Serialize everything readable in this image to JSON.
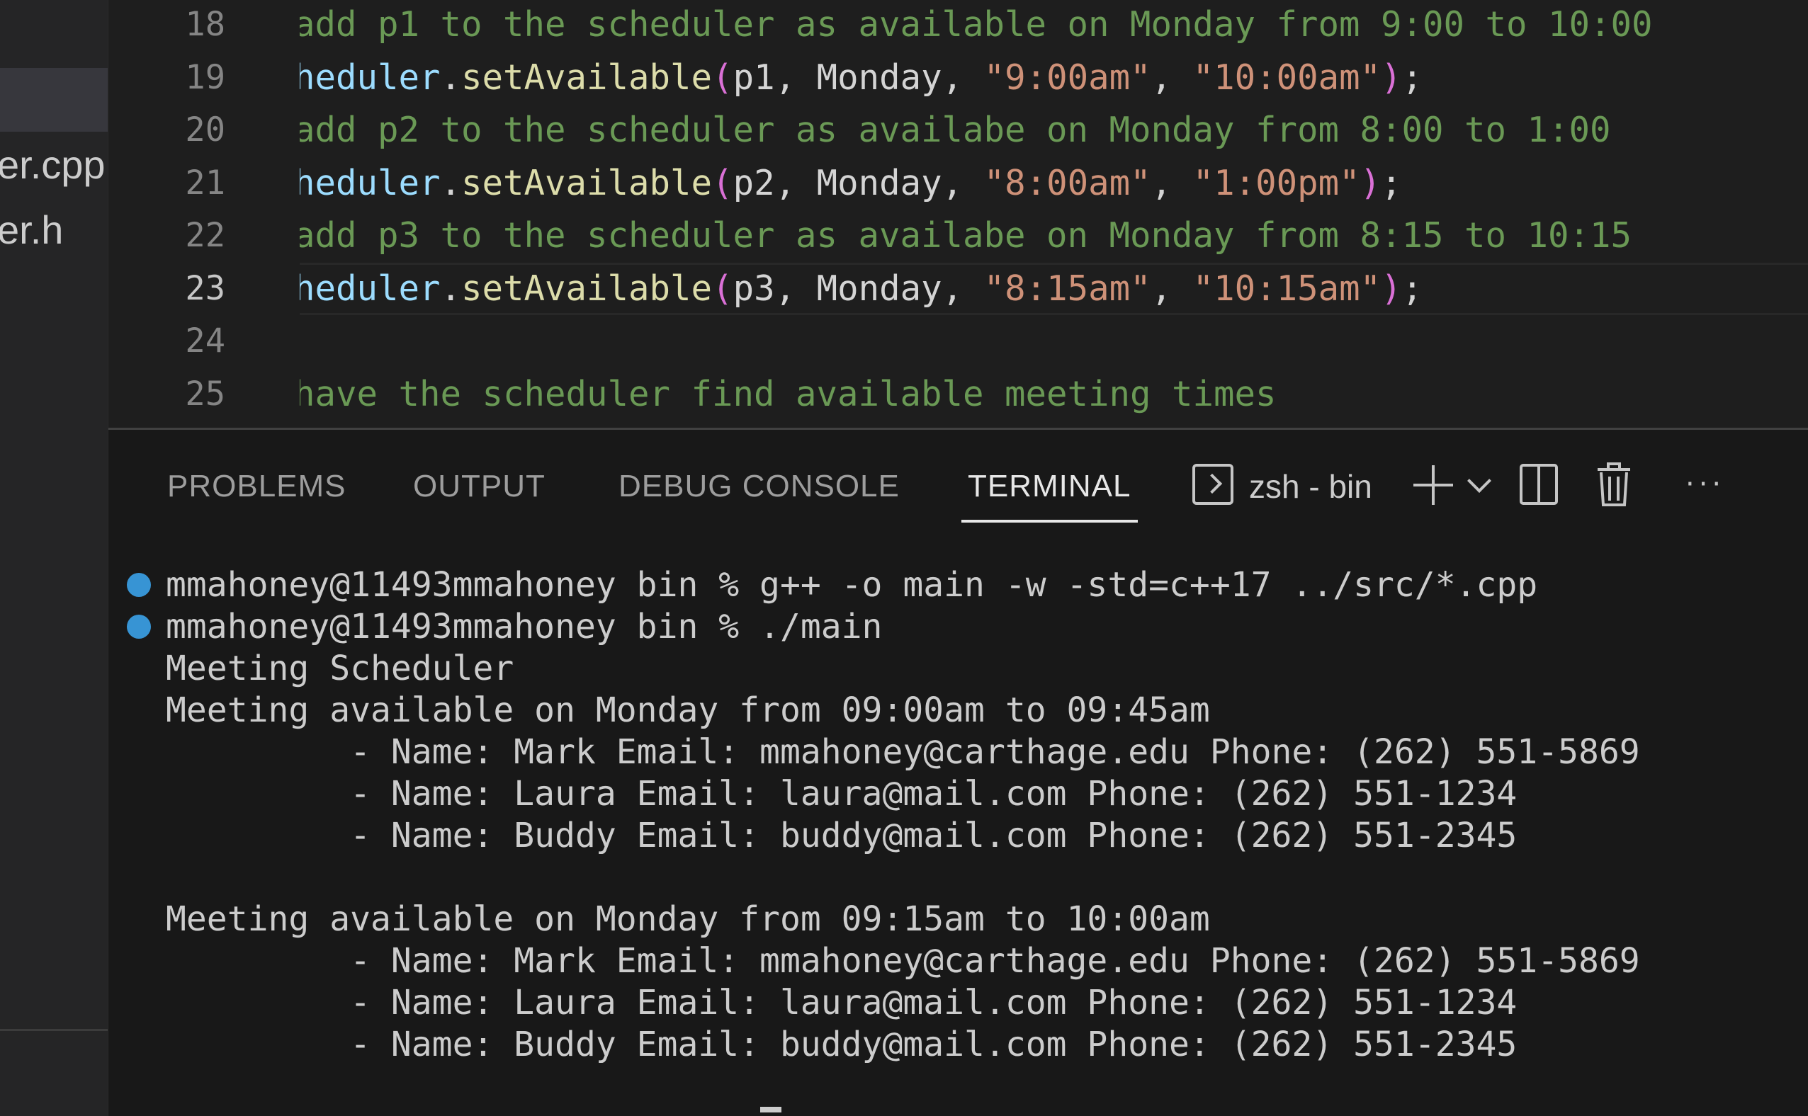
{
  "sidebar": {
    "files": [
      {
        "name": "er.cpp"
      },
      {
        "name": "er.h"
      }
    ]
  },
  "editor": {
    "active_line": "23",
    "lines": [
      {
        "num": "18",
        "tokens": [
          {
            "t": "comment",
            "v": "add p1 to the scheduler as available on Monday from 9:00 to 10:00"
          }
        ]
      },
      {
        "num": "19",
        "tokens": [
          {
            "t": "var",
            "v": "heduler"
          },
          {
            "t": "plain",
            "v": "."
          },
          {
            "t": "fn",
            "v": "setAvailable"
          },
          {
            "t": "paren",
            "v": "("
          },
          {
            "t": "plain",
            "v": "p1, Monday, "
          },
          {
            "t": "str",
            "v": "\"9:00am\""
          },
          {
            "t": "plain",
            "v": ", "
          },
          {
            "t": "str",
            "v": "\"10:00am\""
          },
          {
            "t": "paren",
            "v": ")"
          },
          {
            "t": "plain",
            "v": ";"
          }
        ]
      },
      {
        "num": "20",
        "tokens": [
          {
            "t": "comment",
            "v": "add p2 to the scheduler as availabe on Monday from 8:00 to 1:00"
          }
        ]
      },
      {
        "num": "21",
        "tokens": [
          {
            "t": "var",
            "v": "heduler"
          },
          {
            "t": "plain",
            "v": "."
          },
          {
            "t": "fn",
            "v": "setAvailable"
          },
          {
            "t": "paren",
            "v": "("
          },
          {
            "t": "plain",
            "v": "p2, Monday, "
          },
          {
            "t": "str",
            "v": "\"8:00am\""
          },
          {
            "t": "plain",
            "v": ", "
          },
          {
            "t": "str",
            "v": "\"1:00pm\""
          },
          {
            "t": "paren",
            "v": ")"
          },
          {
            "t": "plain",
            "v": ";"
          }
        ]
      },
      {
        "num": "22",
        "tokens": [
          {
            "t": "comment",
            "v": "add p3 to the scheduler as availabe on Monday from 8:15 to 10:15"
          }
        ]
      },
      {
        "num": "23",
        "tokens": [
          {
            "t": "var",
            "v": "heduler"
          },
          {
            "t": "plain",
            "v": "."
          },
          {
            "t": "fn",
            "v": "setAvailable"
          },
          {
            "t": "paren",
            "v": "("
          },
          {
            "t": "plain",
            "v": "p3, Monday, "
          },
          {
            "t": "str",
            "v": "\"8:15am\""
          },
          {
            "t": "plain",
            "v": ", "
          },
          {
            "t": "str",
            "v": "\"10:15am\""
          },
          {
            "t": "paren",
            "v": ")"
          },
          {
            "t": "plain",
            "v": ";"
          }
        ]
      },
      {
        "num": "24",
        "tokens": []
      },
      {
        "num": "25",
        "tokens": [
          {
            "t": "comment",
            "v": "have the scheduler find available meeting times"
          }
        ]
      }
    ]
  },
  "panel": {
    "tabs": [
      {
        "label": "PROBLEMS"
      },
      {
        "label": "OUTPUT"
      },
      {
        "label": "DEBUG CONSOLE"
      },
      {
        "label": "TERMINAL"
      }
    ],
    "active_tab": "TERMINAL",
    "terminal_name": "zsh - bin",
    "icons": [
      "terminal-icon",
      "plus-icon",
      "chevron-down-icon",
      "split-icon",
      "trash-icon",
      "more-icon",
      "chevron-up-icon"
    ]
  },
  "terminal": {
    "lines": [
      {
        "prompt": true,
        "text": "mmahoney@11493mmahoney bin % g++ -o main -w -std=c++17 ../src/*.cpp"
      },
      {
        "prompt": true,
        "text": "mmahoney@11493mmahoney bin % ./main"
      },
      {
        "prompt": false,
        "text": "Meeting Scheduler"
      },
      {
        "prompt": false,
        "text": "Meeting available on Monday from 09:00am to 09:45am"
      },
      {
        "prompt": false,
        "text": "         - Name: Mark Email: mmahoney@carthage.edu Phone: (262) 551-5869"
      },
      {
        "prompt": false,
        "text": "         - Name: Laura Email: laura@mail.com Phone: (262) 551-1234"
      },
      {
        "prompt": false,
        "text": "         - Name: Buddy Email: buddy@mail.com Phone: (262) 551-2345"
      },
      {
        "prompt": false,
        "text": ""
      },
      {
        "prompt": false,
        "text": "Meeting available on Monday from 09:15am to 10:00am"
      },
      {
        "prompt": false,
        "text": "         - Name: Mark Email: mmahoney@carthage.edu Phone: (262) 551-5869"
      },
      {
        "prompt": false,
        "text": "         - Name: Laura Email: laura@mail.com Phone: (262) 551-1234"
      },
      {
        "prompt": false,
        "text": "         - Name: Buddy Email: buddy@mail.com Phone: (262) 551-2345"
      }
    ]
  },
  "colors": {
    "background": "#1e1e1e",
    "comment": "#6a9955",
    "variable": "#9cdcfe",
    "function": "#dcdcaa",
    "string": "#ce9178",
    "prompt_dot": "#3794d4"
  }
}
